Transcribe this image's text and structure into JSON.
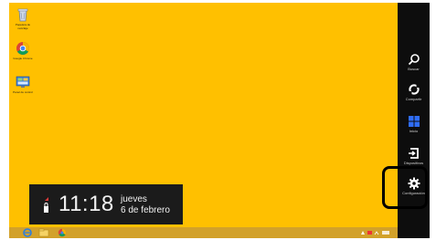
{
  "desktop": {
    "background_color": "#ffc000",
    "icons": [
      {
        "name": "recycle-bin",
        "label": "Papelera de reciclaje"
      },
      {
        "name": "google-chrome",
        "label": "Google Chrome"
      },
      {
        "name": "control-panel",
        "label": "Panel de control"
      }
    ]
  },
  "clock": {
    "time": "11:18",
    "day": "jueves",
    "date": "6 de febrero"
  },
  "charms": [
    {
      "id": "search",
      "label": "Buscar",
      "icon": "search-icon"
    },
    {
      "id": "share",
      "label": "Compartir",
      "icon": "share-icon"
    },
    {
      "id": "start",
      "label": "Inicio",
      "icon": "windows-logo-icon"
    },
    {
      "id": "devices",
      "label": "Dispositivos",
      "icon": "devices-icon"
    },
    {
      "id": "settings",
      "label": "Configuración",
      "icon": "gear-icon",
      "highlighted": true
    }
  ],
  "taskbar": {
    "pinned": [
      "internet-explorer-icon",
      "file-explorer-icon",
      "chrome-icon"
    ]
  },
  "colors": {
    "accent": "#ffc000",
    "charms_bar": "#0d0d0d",
    "clock_panel": "#1b1b1b"
  }
}
